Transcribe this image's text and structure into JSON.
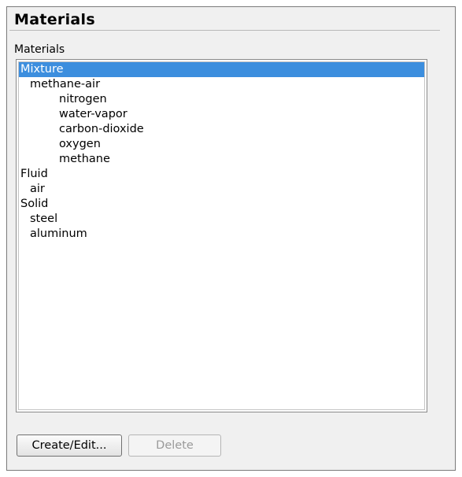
{
  "panel": {
    "title": "Materials",
    "group_label": "Materials"
  },
  "tree": {
    "items": [
      {
        "label": "Mixture",
        "selected": true
      },
      {
        "label": "methane-air"
      },
      {
        "label": "nitrogen"
      },
      {
        "label": "water-vapor"
      },
      {
        "label": "carbon-dioxide"
      },
      {
        "label": "oxygen"
      },
      {
        "label": "methane"
      },
      {
        "label": "Fluid"
      },
      {
        "label": "air"
      },
      {
        "label": "Solid"
      },
      {
        "label": "steel"
      },
      {
        "label": "aluminum"
      }
    ]
  },
  "buttons": {
    "create_edit": "Create/Edit...",
    "delete": "Delete"
  },
  "colors": {
    "selection": "#3c8ede",
    "panel_background": "#f0f0f0",
    "disabled_text": "#9a9a9a"
  }
}
